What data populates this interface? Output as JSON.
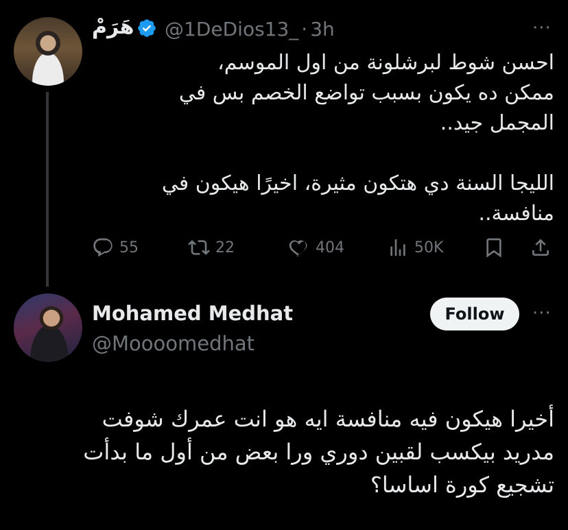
{
  "tweet1": {
    "display_name": "هَرَمْ",
    "handle": "@1DeDios13_",
    "separator": "·",
    "time": "3h",
    "lines": [
      "احسن شوط لبرشلونة من اول الموسم،",
      "ممكن ده يكون بسبب تواضع الخصم بس في",
      "المجمل جيد..",
      "",
      "الليجا السنة دي هتكون مثيرة، اخيرًا هيكون في",
      "منافسة.."
    ],
    "counts": {
      "replies": "55",
      "reposts": "22",
      "likes": "404",
      "views": "50K"
    }
  },
  "tweet2": {
    "display_name": "Mohamed Medhat",
    "handle": "@Moooomedhat",
    "follow_label": "Follow",
    "lines": [
      "أخيرا هيكون فيه منافسة ايه هو انت عمرك شوفت",
      "مدريد بيكسب لقبين دوري ورا بعض من أول ما بدأت",
      "تشجيع كورة اساسا؟"
    ]
  },
  "icons": {
    "verified": "verified-badge-icon",
    "more": "more-dots-icon",
    "reply": "reply-icon",
    "repost": "repost-icon",
    "like": "heart-icon",
    "views": "views-icon",
    "bookmark": "bookmark-icon",
    "share": "share-icon"
  },
  "colors": {
    "background": "#000000",
    "text": "#e7e9ea",
    "muted": "#71767b",
    "verified": "#1d9bf0",
    "follow_bg": "#eff3f4"
  }
}
